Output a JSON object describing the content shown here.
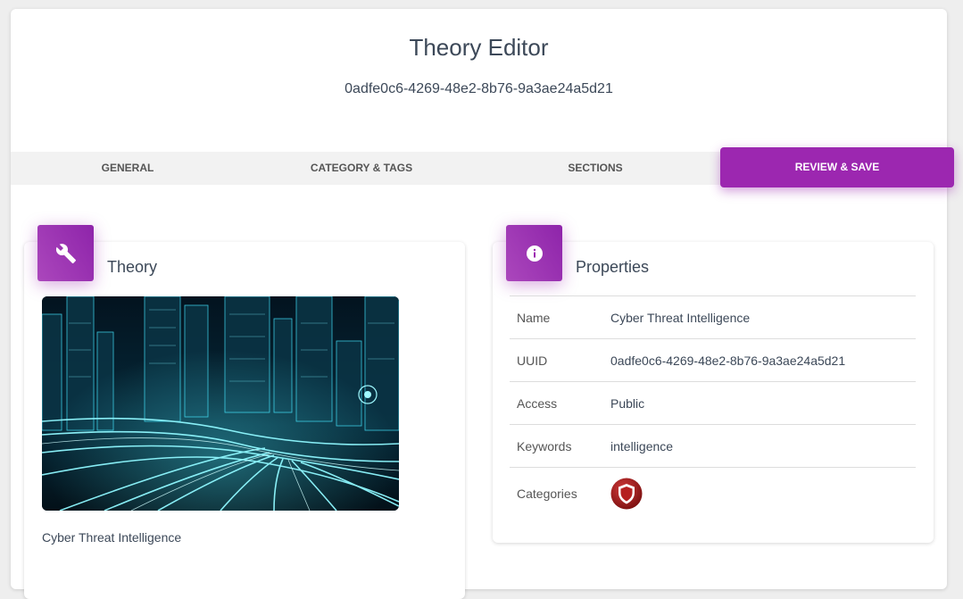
{
  "header": {
    "title": "Theory Editor",
    "uuid": "0adfe0c6-4269-48e2-8b76-9a3ae24a5d21"
  },
  "tabs": [
    {
      "label": "GENERAL",
      "active": false
    },
    {
      "label": "CATEGORY & TAGS",
      "active": false
    },
    {
      "label": "SECTIONS",
      "active": false
    },
    {
      "label": "REVIEW & SAVE",
      "active": true
    }
  ],
  "theory_card": {
    "title": "Theory",
    "icon": "wrench-icon",
    "caption": "Cyber Threat Intelligence"
  },
  "properties_card": {
    "title": "Properties",
    "icon": "info-icon",
    "rows": [
      {
        "key": "Name",
        "value": "Cyber Threat Intelligence"
      },
      {
        "key": "UUID",
        "value": "0adfe0c6-4269-48e2-8b76-9a3ae24a5d21"
      },
      {
        "key": "Access",
        "value": "Public"
      },
      {
        "key": "Keywords",
        "value": "intelligence"
      },
      {
        "key": "Categories",
        "icon": "shield-icon"
      }
    ]
  },
  "colors": {
    "accent": "#9c27b0",
    "badge_red": "#a51c1c"
  }
}
